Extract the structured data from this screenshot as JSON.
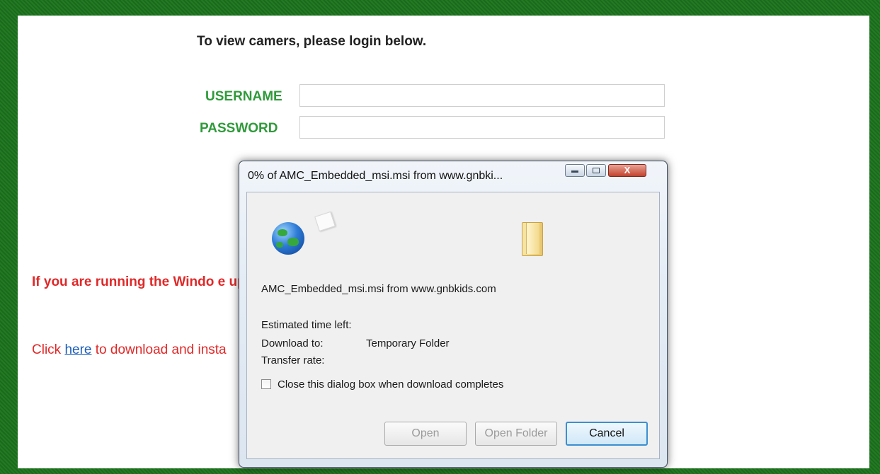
{
  "page": {
    "heading": "To view camers, please login below.",
    "username_label": "USERNAME",
    "password_label": "PASSWORD",
    "username_value": "",
    "password_value": "",
    "warning_text": "If you are running the Windo                                                                                                    e updated viewer software below in order to su",
    "click_prefix": "Click ",
    "click_link": "here",
    "click_suffix": " to download and insta"
  },
  "dialog": {
    "title": "0% of AMC_Embedded_msi.msi from www.gnbki...",
    "file_source": "AMC_Embedded_msi.msi from www.gnbkids.com",
    "estimated_label": "Estimated time left:",
    "download_to_label": "Download to:",
    "download_to_value": "Temporary Folder",
    "transfer_label": "Transfer rate:",
    "checkbox_label": "Close this dialog box when download completes",
    "buttons": {
      "open": "Open",
      "open_folder": "Open Folder",
      "cancel": "Cancel"
    },
    "close_glyph": "X",
    "icons": [
      "globe-icon",
      "document-icon",
      "folder-icon"
    ]
  },
  "colors": {
    "frame": "#1e6a1e",
    "label_green": "#2f9a3a",
    "warning_red": "#e02828",
    "link_blue": "#1d5fb8"
  }
}
